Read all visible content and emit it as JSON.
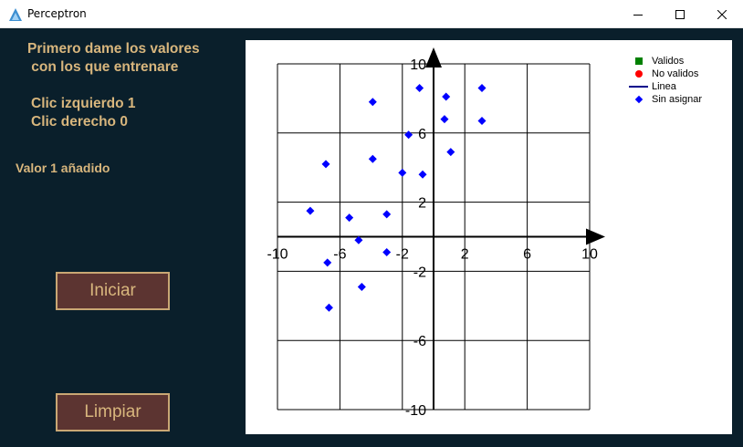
{
  "window": {
    "title": "Perceptron"
  },
  "panel": {
    "instruction": "Primero dame los valores\n con los que entrenare",
    "click_left": "Clic izquierdo 1",
    "click_right": "Clic derecho 0",
    "status": "Valor 1 añadido",
    "start_button": "Iniciar",
    "clear_button": "Limpiar"
  },
  "colors": {
    "panel_bg": "#0a1f2b",
    "label_text": "#d8b67d",
    "button_bg": "#5c3431",
    "button_border": "#c9a774",
    "valid": "#008000",
    "invalid": "#ff0000",
    "line": "#00008b",
    "unassigned": "#0000ff"
  },
  "chart_data": {
    "type": "scatter",
    "xlim": [
      -10,
      10
    ],
    "ylim": [
      -10,
      10
    ],
    "x_ticks": [
      -10,
      -6,
      -2,
      2,
      6,
      10
    ],
    "y_ticks": [
      -10,
      -6,
      -2,
      2,
      6,
      10
    ],
    "x_tick_labels": [
      "-10",
      "-6",
      "-2",
      "2",
      "6",
      "10"
    ],
    "y_tick_labels": [
      "-10",
      "-6",
      "-2",
      "2",
      "6",
      "10"
    ],
    "grid": true,
    "legend_position": "top-right",
    "legend": [
      {
        "label": "Validos",
        "marker": "square",
        "color": "#008000"
      },
      {
        "label": "No validos",
        "marker": "circle",
        "color": "#ff0000"
      },
      {
        "label": "Linea",
        "marker": "line",
        "color": "#00008b"
      },
      {
        "label": "Sin asignar",
        "marker": "diamond",
        "color": "#0000ff"
      }
    ],
    "series": [
      {
        "name": "Sin asignar",
        "color": "#0000ff",
        "points": [
          [
            -3.9,
            7.8
          ],
          [
            -0.9,
            8.6
          ],
          [
            0.8,
            8.1
          ],
          [
            3.1,
            8.6
          ],
          [
            0.7,
            6.8
          ],
          [
            3.1,
            6.7
          ],
          [
            -1.6,
            5.9
          ],
          [
            1.1,
            4.9
          ],
          [
            -6.9,
            4.2
          ],
          [
            -3.9,
            4.5
          ],
          [
            -2.0,
            3.7
          ],
          [
            -0.7,
            3.6
          ],
          [
            -7.9,
            1.5
          ],
          [
            -5.4,
            1.1
          ],
          [
            -3.0,
            1.3
          ],
          [
            -4.8,
            -0.2
          ],
          [
            -3.0,
            -0.9
          ],
          [
            -6.8,
            -1.5
          ],
          [
            -4.6,
            -2.9
          ],
          [
            -6.7,
            -4.1
          ]
        ]
      }
    ]
  }
}
